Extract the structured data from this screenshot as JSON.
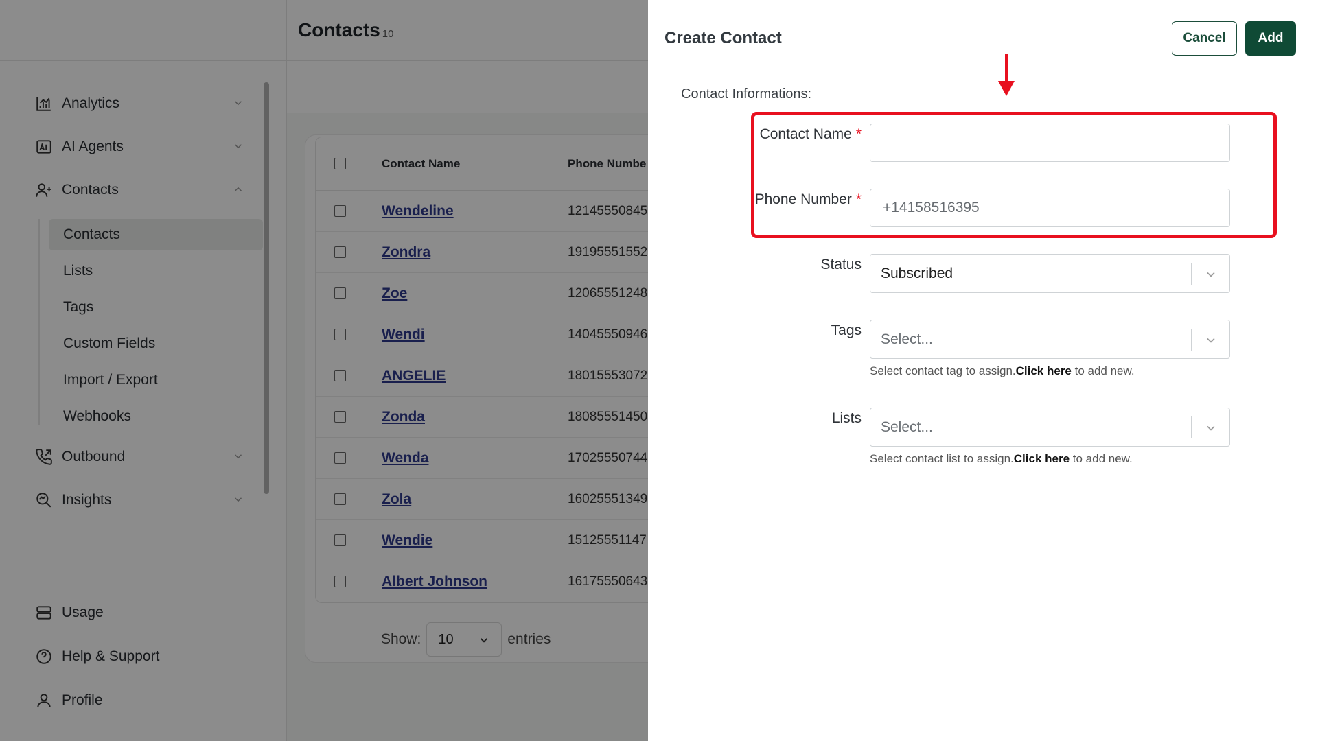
{
  "sidebar": {
    "items": [
      {
        "label": "Analytics",
        "icon": "chart-icon"
      },
      {
        "label": "AI Agents",
        "icon": "ai-agent-icon"
      },
      {
        "label": "Contacts",
        "icon": "user-plus-icon"
      },
      {
        "label": "Outbound",
        "icon": "phone-outgoing-icon"
      },
      {
        "label": "Insights",
        "icon": "insights-icon"
      }
    ],
    "contacts_sub": [
      "Contacts",
      "Lists",
      "Tags",
      "Custom Fields",
      "Import / Export",
      "Webhooks"
    ],
    "bottom": [
      {
        "label": "Usage",
        "icon": "server-icon"
      },
      {
        "label": "Help & Support",
        "icon": "help-circle-icon"
      },
      {
        "label": "Profile",
        "icon": "user-icon"
      }
    ]
  },
  "page": {
    "title": "Contacts",
    "count": "10"
  },
  "table": {
    "columns": [
      "Contact Name",
      "Phone Numbe"
    ],
    "rows": [
      {
        "name": "Wendeline",
        "phone": "12145550845"
      },
      {
        "name": "Zondra",
        "phone": "19195551552"
      },
      {
        "name": "Zoe",
        "phone": "12065551248"
      },
      {
        "name": "Wendi",
        "phone": "14045550946"
      },
      {
        "name": "ANGELIE",
        "phone": "18015553072"
      },
      {
        "name": "Zonda",
        "phone": "18085551450"
      },
      {
        "name": "Wenda",
        "phone": "17025550744"
      },
      {
        "name": "Zola",
        "phone": "16025551349"
      },
      {
        "name": "Wendie",
        "phone": "15125551147"
      },
      {
        "name": "Albert Johnson",
        "phone": "16175550643"
      }
    ],
    "show_label": "Show:",
    "show_value": "10",
    "entries_label": "entries"
  },
  "drawer": {
    "title": "Create Contact",
    "cancel": "Cancel",
    "add": "Add",
    "section": "Contact Informations:",
    "contact_name_label": "Contact Name",
    "phone_label": "Phone Number",
    "required_mark": "*",
    "contact_name_value": "",
    "phone_placeholder": "+14158516395",
    "status_label": "Status",
    "status_value": "Subscribed",
    "tags_label": "Tags",
    "tags_placeholder": "Select...",
    "tags_hint_pre": "Select contact tag to assign.",
    "tags_hint_link": "Click here",
    "tags_hint_post": " to add new.",
    "lists_label": "Lists",
    "lists_placeholder": "Select...",
    "lists_hint_pre": "Select contact list to assign.",
    "lists_hint_link": "Click here",
    "lists_hint_post": " to add new."
  },
  "colors": {
    "primary": "#0f4a35",
    "highlight": "#e8101f",
    "link": "#2e3a8c"
  }
}
